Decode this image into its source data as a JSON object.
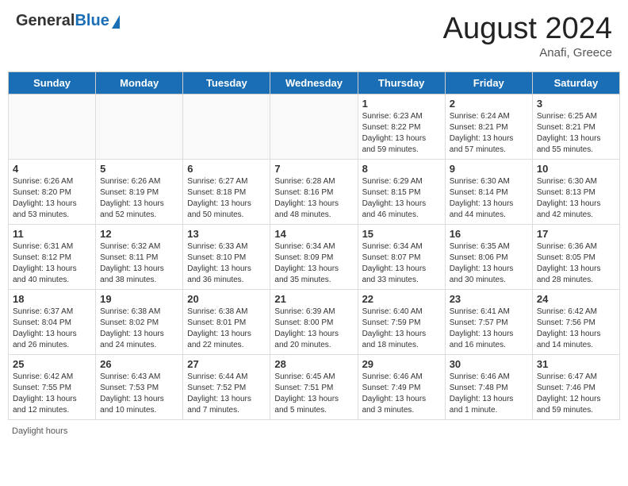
{
  "header": {
    "logo_general": "General",
    "logo_blue": "Blue",
    "title": "August 2024",
    "subtitle": "Anafi, Greece"
  },
  "footer": {
    "daylight_label": "Daylight hours"
  },
  "calendar": {
    "days_of_week": [
      "Sunday",
      "Monday",
      "Tuesday",
      "Wednesday",
      "Thursday",
      "Friday",
      "Saturday"
    ],
    "weeks": [
      [
        {
          "day": "",
          "info": ""
        },
        {
          "day": "",
          "info": ""
        },
        {
          "day": "",
          "info": ""
        },
        {
          "day": "",
          "info": ""
        },
        {
          "day": "1",
          "info": "Sunrise: 6:23 AM\nSunset: 8:22 PM\nDaylight: 13 hours and 59 minutes."
        },
        {
          "day": "2",
          "info": "Sunrise: 6:24 AM\nSunset: 8:21 PM\nDaylight: 13 hours and 57 minutes."
        },
        {
          "day": "3",
          "info": "Sunrise: 6:25 AM\nSunset: 8:21 PM\nDaylight: 13 hours and 55 minutes."
        }
      ],
      [
        {
          "day": "4",
          "info": "Sunrise: 6:26 AM\nSunset: 8:20 PM\nDaylight: 13 hours and 53 minutes."
        },
        {
          "day": "5",
          "info": "Sunrise: 6:26 AM\nSunset: 8:19 PM\nDaylight: 13 hours and 52 minutes."
        },
        {
          "day": "6",
          "info": "Sunrise: 6:27 AM\nSunset: 8:18 PM\nDaylight: 13 hours and 50 minutes."
        },
        {
          "day": "7",
          "info": "Sunrise: 6:28 AM\nSunset: 8:16 PM\nDaylight: 13 hours and 48 minutes."
        },
        {
          "day": "8",
          "info": "Sunrise: 6:29 AM\nSunset: 8:15 PM\nDaylight: 13 hours and 46 minutes."
        },
        {
          "day": "9",
          "info": "Sunrise: 6:30 AM\nSunset: 8:14 PM\nDaylight: 13 hours and 44 minutes."
        },
        {
          "day": "10",
          "info": "Sunrise: 6:30 AM\nSunset: 8:13 PM\nDaylight: 13 hours and 42 minutes."
        }
      ],
      [
        {
          "day": "11",
          "info": "Sunrise: 6:31 AM\nSunset: 8:12 PM\nDaylight: 13 hours and 40 minutes."
        },
        {
          "day": "12",
          "info": "Sunrise: 6:32 AM\nSunset: 8:11 PM\nDaylight: 13 hours and 38 minutes."
        },
        {
          "day": "13",
          "info": "Sunrise: 6:33 AM\nSunset: 8:10 PM\nDaylight: 13 hours and 36 minutes."
        },
        {
          "day": "14",
          "info": "Sunrise: 6:34 AM\nSunset: 8:09 PM\nDaylight: 13 hours and 35 minutes."
        },
        {
          "day": "15",
          "info": "Sunrise: 6:34 AM\nSunset: 8:07 PM\nDaylight: 13 hours and 33 minutes."
        },
        {
          "day": "16",
          "info": "Sunrise: 6:35 AM\nSunset: 8:06 PM\nDaylight: 13 hours and 30 minutes."
        },
        {
          "day": "17",
          "info": "Sunrise: 6:36 AM\nSunset: 8:05 PM\nDaylight: 13 hours and 28 minutes."
        }
      ],
      [
        {
          "day": "18",
          "info": "Sunrise: 6:37 AM\nSunset: 8:04 PM\nDaylight: 13 hours and 26 minutes."
        },
        {
          "day": "19",
          "info": "Sunrise: 6:38 AM\nSunset: 8:02 PM\nDaylight: 13 hours and 24 minutes."
        },
        {
          "day": "20",
          "info": "Sunrise: 6:38 AM\nSunset: 8:01 PM\nDaylight: 13 hours and 22 minutes."
        },
        {
          "day": "21",
          "info": "Sunrise: 6:39 AM\nSunset: 8:00 PM\nDaylight: 13 hours and 20 minutes."
        },
        {
          "day": "22",
          "info": "Sunrise: 6:40 AM\nSunset: 7:59 PM\nDaylight: 13 hours and 18 minutes."
        },
        {
          "day": "23",
          "info": "Sunrise: 6:41 AM\nSunset: 7:57 PM\nDaylight: 13 hours and 16 minutes."
        },
        {
          "day": "24",
          "info": "Sunrise: 6:42 AM\nSunset: 7:56 PM\nDaylight: 13 hours and 14 minutes."
        }
      ],
      [
        {
          "day": "25",
          "info": "Sunrise: 6:42 AM\nSunset: 7:55 PM\nDaylight: 13 hours and 12 minutes."
        },
        {
          "day": "26",
          "info": "Sunrise: 6:43 AM\nSunset: 7:53 PM\nDaylight: 13 hours and 10 minutes."
        },
        {
          "day": "27",
          "info": "Sunrise: 6:44 AM\nSunset: 7:52 PM\nDaylight: 13 hours and 7 minutes."
        },
        {
          "day": "28",
          "info": "Sunrise: 6:45 AM\nSunset: 7:51 PM\nDaylight: 13 hours and 5 minutes."
        },
        {
          "day": "29",
          "info": "Sunrise: 6:46 AM\nSunset: 7:49 PM\nDaylight: 13 hours and 3 minutes."
        },
        {
          "day": "30",
          "info": "Sunrise: 6:46 AM\nSunset: 7:48 PM\nDaylight: 13 hours and 1 minute."
        },
        {
          "day": "31",
          "info": "Sunrise: 6:47 AM\nSunset: 7:46 PM\nDaylight: 12 hours and 59 minutes."
        }
      ]
    ]
  }
}
